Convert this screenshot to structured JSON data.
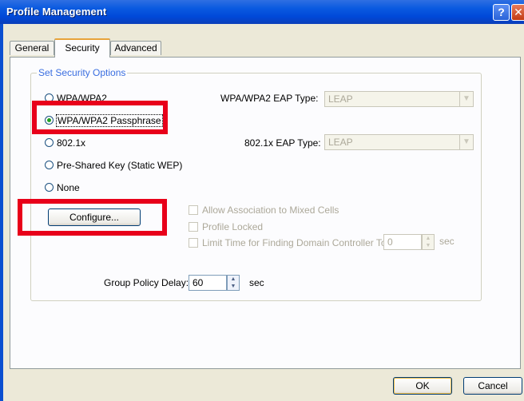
{
  "window": {
    "title": "Profile Management",
    "help_glyph": "?",
    "close_glyph": "✕"
  },
  "tabs": [
    {
      "label": "General",
      "active": false
    },
    {
      "label": "Security",
      "active": true
    },
    {
      "label": "Advanced",
      "active": false
    }
  ],
  "security": {
    "group_title": "Set Security Options",
    "options": [
      {
        "label": "WPA/WPA2",
        "checked": false
      },
      {
        "label": "WPA/WPA2 Passphrase",
        "checked": true
      },
      {
        "label": "802.1x",
        "checked": false
      },
      {
        "label": "Pre-Shared Key (Static WEP)",
        "checked": false
      },
      {
        "label": "None",
        "checked": false
      }
    ],
    "wpa_eap_label": "WPA/WPA2 EAP Type:",
    "wpa_eap_value": "LEAP",
    "dot1x_eap_label": "802.1x EAP Type:",
    "dot1x_eap_value": "LEAP",
    "configure_label": "Configure...",
    "checkboxes": [
      {
        "label": "Allow Association to Mixed Cells",
        "checked": false,
        "enabled": false
      },
      {
        "label": "Profile Locked",
        "checked": false,
        "enabled": false
      },
      {
        "label": "Limit Time for Finding Domain Controller To:",
        "checked": false,
        "enabled": false
      }
    ],
    "domain_timeout_value": "0",
    "domain_timeout_unit": "sec",
    "group_policy_label": "Group Policy Delay:",
    "group_policy_value": "60",
    "group_policy_unit": "sec"
  },
  "footer": {
    "ok_label": "OK",
    "cancel_label": "Cancel"
  },
  "annotation_color": "#e8001a"
}
